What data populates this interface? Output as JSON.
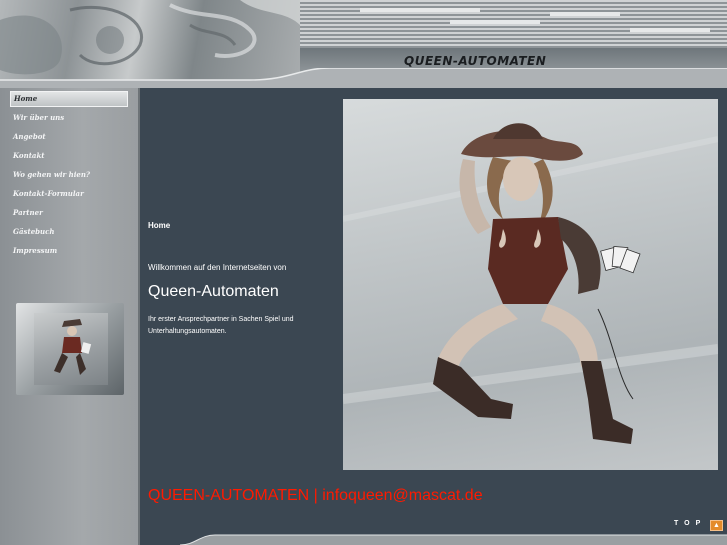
{
  "header": {
    "title": "QUEEN-AUTOMATEN",
    "art": "etched-woman-artwork"
  },
  "sidebar": {
    "items": [
      {
        "label": "Home",
        "active": true
      },
      {
        "label": "Wir über uns"
      },
      {
        "label": "Angebot"
      },
      {
        "label": "Kontakt"
      },
      {
        "label": "Wo gehen wir hien?"
      },
      {
        "label": "Kontakt-Formular"
      },
      {
        "label": "Partner"
      },
      {
        "label": "Gästebuch"
      },
      {
        "label": "Impressum"
      }
    ],
    "thumbnail": "cowgirl-thumbnail"
  },
  "main": {
    "heading": "Home",
    "welcome": "Willkommen auf den Internetseiten von",
    "site_name": "Queen-Automaten",
    "description": "Ihr erster Ansprechpartner in Sachen Spiel und Unterhaltungsautomaten.",
    "hero_image": "cowgirl-playing-cards-etching",
    "contact_line": "QUEEN-AUTOMATEN | infoqueen@mascat.de",
    "top_label": "TOP",
    "top_icon": "up-arrow-icon"
  },
  "colors": {
    "background": "#3b4752",
    "sidebar": "#9a9ea1",
    "contact_red": "#ff1a00",
    "top_icon": "#e48b2a"
  }
}
